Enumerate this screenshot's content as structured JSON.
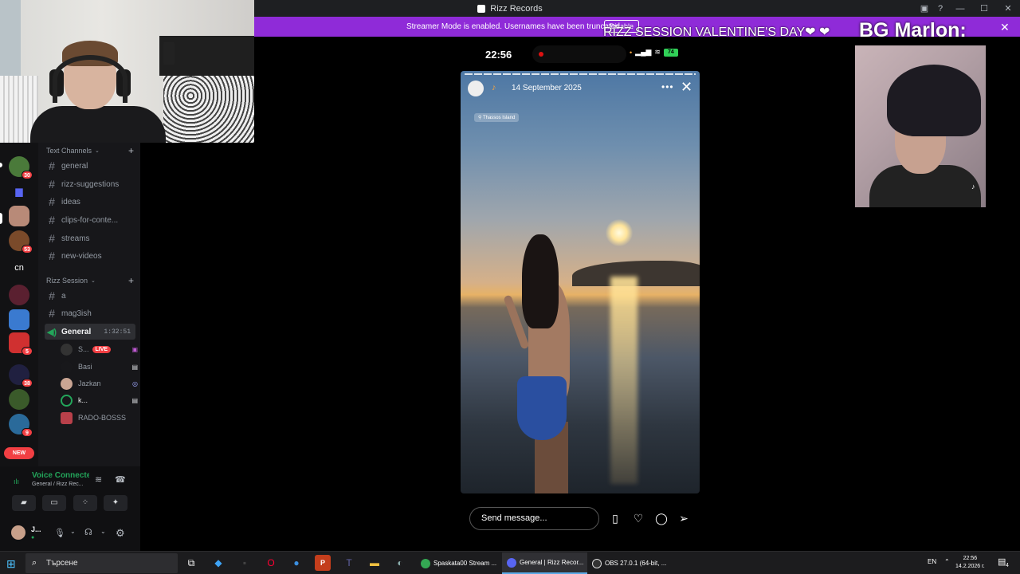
{
  "window": {
    "title": "Rizz Records"
  },
  "banner": {
    "text": "Streamer Mode is enabled. Usernames have been truncated.",
    "disable_label": "Disable",
    "overlay_title": "RIZZ SESSION VALENTINE'S DAY❤ ❤",
    "overlay_name": "BG Marlon:"
  },
  "guilds": {
    "badges": [
      "30",
      "53",
      "5",
      "38",
      "9"
    ],
    "text_guild": "cn",
    "new_label": "NEW"
  },
  "categories": {
    "text": "Text Channels",
    "session": "Rizz Session"
  },
  "channels": [
    {
      "name": "general"
    },
    {
      "name": "rizz-suggestions"
    },
    {
      "name": "ideas"
    },
    {
      "name": "clips-for-conte..."
    },
    {
      "name": "streams"
    },
    {
      "name": "new-videos"
    }
  ],
  "session_channels": [
    {
      "name": "a"
    },
    {
      "name": "mag3ish"
    }
  ],
  "voice_channel": {
    "name": "General",
    "timer": "1:32:51"
  },
  "voice_users": [
    {
      "name": "S...",
      "live": "LIVE"
    },
    {
      "name": "Basi"
    },
    {
      "name": "Jazkan"
    },
    {
      "name": "k..."
    },
    {
      "name": "RADO-BOSSS"
    }
  ],
  "voice_panel": {
    "status": "Voice Connected",
    "sub": "General / Rizz Rec...",
    "user": "J..."
  },
  "phone": {
    "time": "22:56",
    "battery": "74"
  },
  "story": {
    "date": "14 September 2025",
    "location": "Thassos Island"
  },
  "message": {
    "placeholder": "Send message..."
  },
  "taskbar": {
    "search": "Търсене",
    "windows": [
      {
        "label": "Spaskata00 Stream ..."
      },
      {
        "label": "General | Rizz Recor..."
      },
      {
        "label": "OBS 27.0.1 (64-bit, ..."
      }
    ],
    "lang": "EN",
    "time": "22:56",
    "date": "14.2.2026 г.",
    "notif": "4"
  }
}
